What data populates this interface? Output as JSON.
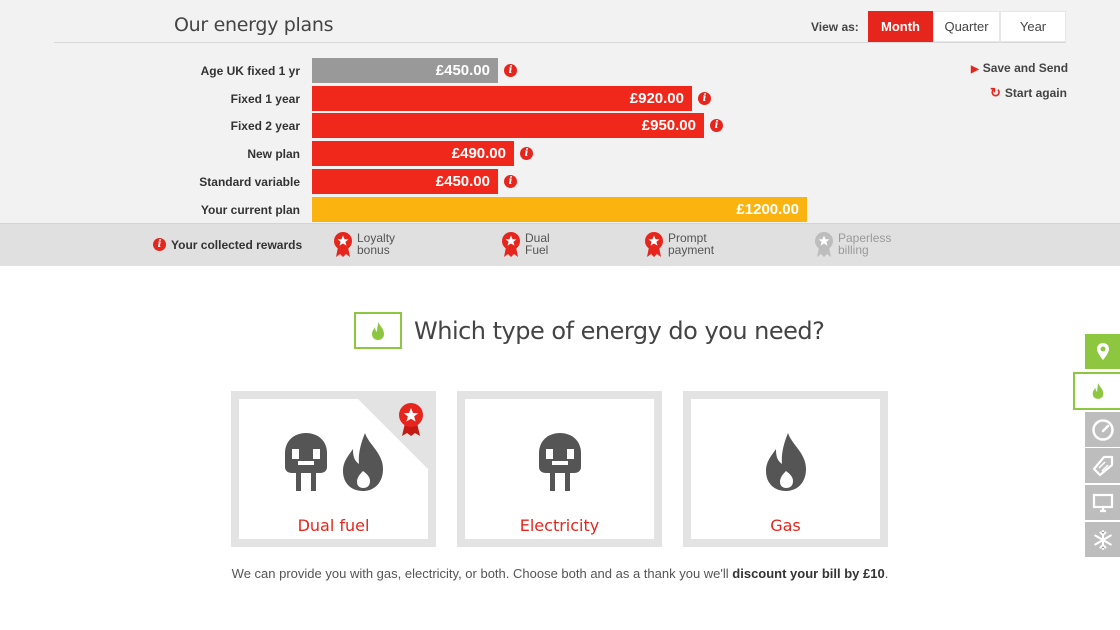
{
  "header": {
    "title": "Our energy plans"
  },
  "view_toggle": {
    "label": "View as:",
    "options": [
      "Month",
      "Quarter",
      "Year"
    ],
    "selected": "Month"
  },
  "plans": [
    {
      "name": "Age UK fixed 1 yr",
      "amount": "£450.00",
      "value": 450,
      "color": "#999999",
      "info": true
    },
    {
      "name": "Fixed 1 year",
      "amount": "£920.00",
      "value": 920,
      "color": "#f0281c",
      "info": true
    },
    {
      "name": "Fixed 2 year",
      "amount": "£950.00",
      "value": 950,
      "color": "#f0281c",
      "info": true
    },
    {
      "name": "New plan",
      "amount": "£490.00",
      "value": 490,
      "color": "#f0281c",
      "info": true
    },
    {
      "name": "Standard variable",
      "amount": "£450.00",
      "value": 450,
      "color": "#f0281c",
      "info": true
    },
    {
      "name": "Your current plan",
      "amount": "£1200.00",
      "value": 1200,
      "color": "#fbb30f",
      "info": false
    }
  ],
  "actions": {
    "save_send": "Save and Send",
    "start_again": "Start again"
  },
  "rewards": {
    "label": "Your collected rewards",
    "items": [
      {
        "line1": "Loyalty",
        "line2": "bonus",
        "collected": true
      },
      {
        "line1": "Dual",
        "line2": "Fuel",
        "collected": true
      },
      {
        "line1": "Prompt",
        "line2": "payment",
        "collected": true
      },
      {
        "line1": "Paperless",
        "line2": "billing",
        "collected": false
      }
    ]
  },
  "question": {
    "text": "Which type of energy do you need?"
  },
  "energy_options": [
    {
      "label": "Dual fuel",
      "icons": [
        "plug-icon",
        "flame-icon"
      ],
      "badge": true
    },
    {
      "label": "Electricity",
      "icons": [
        "plug-icon"
      ],
      "badge": false
    },
    {
      "label": "Gas",
      "icons": [
        "flame-icon"
      ],
      "badge": false
    }
  ],
  "footnote": {
    "text": "We can provide you with gas, electricity, or both. Choose both and as a thank you we'll ",
    "bold": "discount your bill by £10",
    "end": "."
  },
  "sidebar_tabs": [
    {
      "icon": "location-pin-icon",
      "state": "done"
    },
    {
      "icon": "flame-icon",
      "state": "current"
    },
    {
      "icon": "meter-icon",
      "state": "pending"
    },
    {
      "icon": "tag-icon",
      "state": "pending"
    },
    {
      "icon": "monitor-icon",
      "state": "pending"
    },
    {
      "icon": "snowflake-icon",
      "state": "pending"
    }
  ],
  "colors": {
    "brand_red": "#e6261c",
    "amber": "#fbb30f",
    "green": "#8dc63f",
    "grey_bar": "#999999"
  }
}
